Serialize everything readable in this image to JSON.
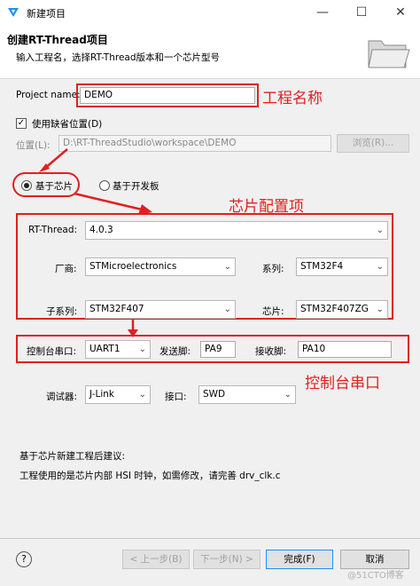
{
  "window": {
    "title": "新建项目",
    "minimize": "—",
    "maximize": "☐",
    "close": "✕"
  },
  "banner": {
    "title": "创建RT-Thread项目",
    "description": "输入工程名，选择RT-Thread版本和一个芯片型号"
  },
  "project": {
    "name_label": "Project name:",
    "name_value": "DEMO",
    "use_default_location": "使用缺省位置(D)",
    "location_label": "位置(L):",
    "location_value": "D:\\RT-ThreadStudio\\workspace\\DEMO",
    "browse": "浏览(R)..."
  },
  "mode": {
    "chip": "基于芯片",
    "board": "基于开发板"
  },
  "config": {
    "rtthread_label": "RT-Thread:",
    "rtthread_value": "4.0.3",
    "vendor_label": "厂商:",
    "vendor_value": "STMicroelectronics",
    "series_label": "系列:",
    "series_value": "STM32F4",
    "subseries_label": "子系列:",
    "subseries_value": "STM32F407",
    "chip_label": "芯片:",
    "chip_value": "STM32F407ZG",
    "console_label": "控制台串口:",
    "console_value": "UART1",
    "tx_label": "发送脚:",
    "tx_value": "PA9",
    "rx_label": "接收脚:",
    "rx_value": "PA10",
    "debugger_label": "调试器:",
    "debugger_value": "J-Link",
    "interface_label": "接口:",
    "interface_value": "SWD"
  },
  "advice": {
    "title": "基于芯片新建工程后建议:",
    "text": "工程使用的是芯片内部 HSI 时钟，如需修改，请完善 drv_clk.c"
  },
  "footer": {
    "help": "?",
    "back": "< 上一步(B)",
    "next": "下一步(N) >",
    "finish": "完成(F)",
    "cancel": "取消"
  },
  "annotations": {
    "project_name": "工程名称",
    "chip_config": "芯片配置项",
    "console_port": "控制台串口",
    "watermark": "@51CTO博客"
  },
  "colors": {
    "annotation": "#e02020",
    "accent": "#1e90ff"
  }
}
